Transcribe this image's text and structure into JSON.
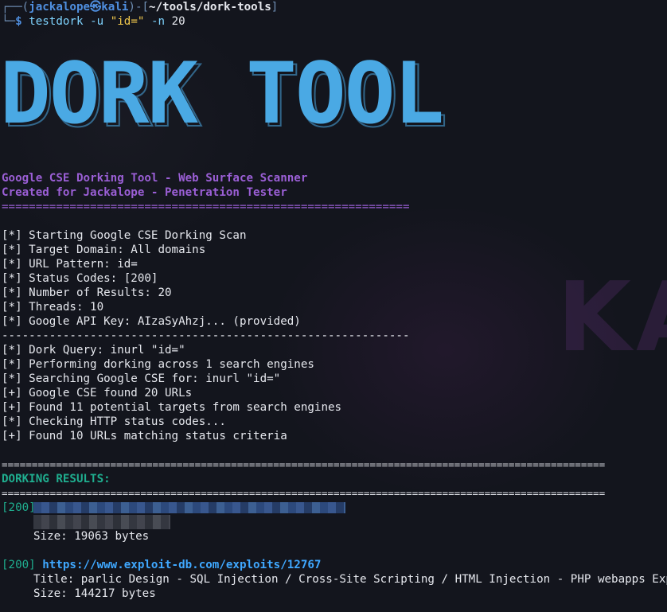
{
  "prompt": {
    "corner_top": "┌──(",
    "user": "jackalope㉿kali",
    "mid": ")-[",
    "path": "~/tools/dork-tools",
    "close": "]",
    "corner_bottom": "└─",
    "dollar": "$",
    "command": "testdork",
    "flag_u": "-u",
    "arg_u": "\"id=\"",
    "flag_n": "-n",
    "arg_n": "20"
  },
  "banner": {
    "text": "DORK TOOL",
    "color": "#4aa9e4"
  },
  "header": {
    "subtitle": "Google CSE Dorking Tool - Web Surface Scanner",
    "created": "Created for Jackalope - Penetration Tester",
    "separator": "============================================================"
  },
  "config": {
    "lines": [
      "[*] Starting Google CSE Dorking Scan",
      "[*] Target Domain: All domains",
      "[*] URL Pattern: id=",
      "[*] Status Codes: [200]",
      "[*] Number of Results: 20",
      "[*] Threads: 10",
      "[*] Google API Key: AIzaSyAhzj... (provided)"
    ],
    "dash_separator": "------------------------------------------------------------"
  },
  "progress": {
    "lines": [
      "[*] Dork Query: inurl \"id=\"",
      "[*] Performing dorking across 1 search engines",
      "[*] Searching Google CSE for: inurl \"id=\"",
      "[+] Google CSE found 20 URLs",
      "[+] Found 11 potential targets from search engines",
      "[*] Checking HTTP status codes...",
      "[+] Found 10 URLs matching status criteria"
    ]
  },
  "results": {
    "separator": "====================================================================================================",
    "heading": "DORKING RESULTS:",
    "items": [
      {
        "status": "[200]",
        "url": "",
        "size": "Size: 19063 bytes"
      },
      {
        "status": "[200]",
        "url": "https://www.exploit-db.com/exploits/12767",
        "title": "Title: parlic Design - SQL Injection / Cross-Site Scripting / HTML Injection - PHP webapps Exploit",
        "size": "Size: 144217 bytes"
      }
    ]
  },
  "watermark": "KA"
}
